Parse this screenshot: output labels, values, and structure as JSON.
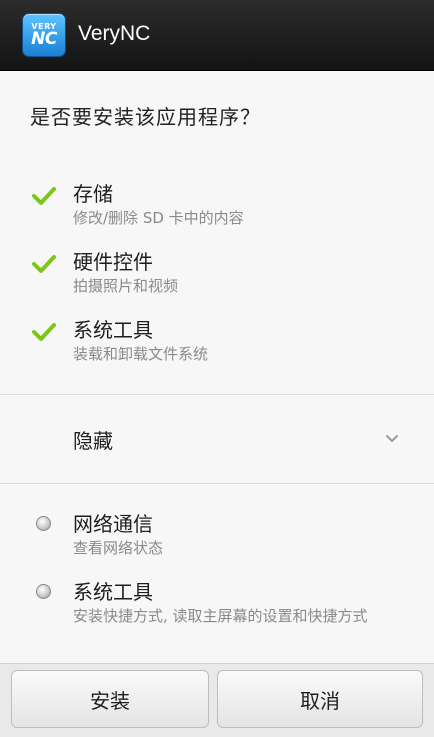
{
  "titlebar": {
    "app_name": "VeryNC",
    "icon_top": "VERY",
    "icon_bottom": "NC"
  },
  "prompt": "是否要安装该应用程序？",
  "granted_permissions": [
    {
      "title": "存储",
      "desc": "修改/删除 SD 卡中的内容"
    },
    {
      "title": "硬件控件",
      "desc": "拍摄照片和视频"
    },
    {
      "title": "系统工具",
      "desc": "装载和卸载文件系统"
    }
  ],
  "hidden_section": {
    "label": "隐藏"
  },
  "other_permissions": [
    {
      "title": "网络通信",
      "desc": "查看网络状态"
    },
    {
      "title": "系统工具",
      "desc": "安装快捷方式, 读取主屏幕的设置和快捷方式"
    }
  ],
  "buttons": {
    "install": "安装",
    "cancel": "取消"
  },
  "colors": {
    "check": "#7cc61a",
    "titlebar": "#1c1c1c",
    "background": "#f7f7f7"
  }
}
